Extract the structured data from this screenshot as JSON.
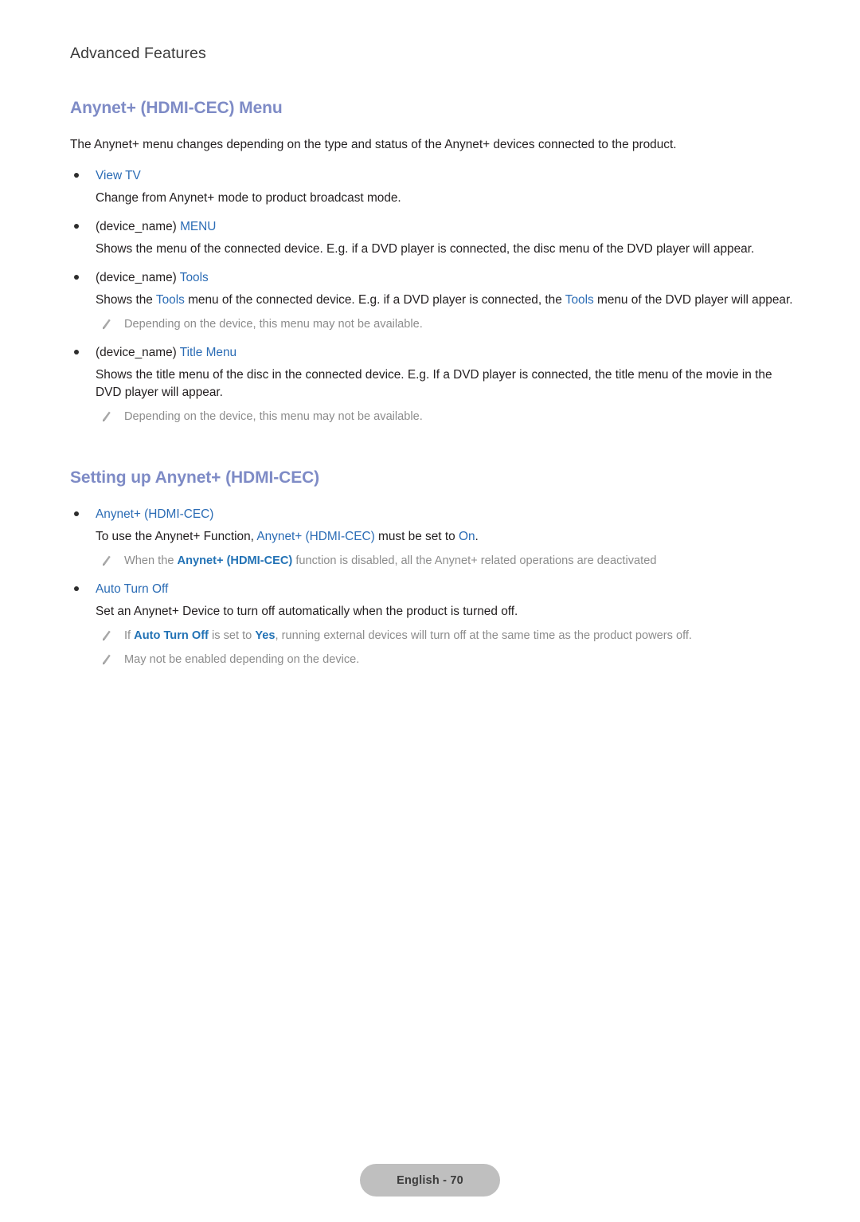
{
  "page": {
    "running_head": "Advanced Features",
    "footer_label": "English - 70"
  },
  "colors": {
    "heading": "#7e8bc6",
    "link": "#2b6cb5",
    "body_text": "#231f20",
    "note_text": "#8c8c8c",
    "badge_bg": "#bfbfbf"
  },
  "sections": [
    {
      "heading": "Anynet+ (HDMI-CEC) Menu",
      "intro": "The Anynet+ menu changes depending on the type and status of the Anynet+ devices connected to the product.",
      "items": [
        {
          "title_plain": "",
          "title_link": "View TV",
          "body": "Change from Anynet+ mode to product broadcast mode.",
          "notes": []
        },
        {
          "title_plain": "(device_name) ",
          "title_link": "MENU",
          "body_pre": "Shows the menu of the connected device. E.g. if a DVD player is connected, the disc menu of the DVD player will appear.",
          "notes": []
        },
        {
          "title_plain": "(device_name) ",
          "title_link": "Tools",
          "body_p1": "Shows the ",
          "body_l1": "Tools",
          "body_p2": " menu of the connected device. E.g. if a DVD player is connected, the ",
          "body_l2": "Tools",
          "body_p3": " menu of the DVD player will appear.",
          "notes": [
            {
              "text": "Depending on the device, this menu may not be available."
            }
          ]
        },
        {
          "title_plain": "(device_name) ",
          "title_link": "Title Menu",
          "body": "Shows the title menu of the disc in the connected device. E.g. If a DVD player is connected, the title menu of the movie in the DVD player will appear.",
          "notes": [
            {
              "text": "Depending on the device, this menu may not be available."
            }
          ]
        }
      ]
    },
    {
      "heading": "Setting up Anynet+ (HDMI-CEC)",
      "items": [
        {
          "title_link": "Anynet+ (HDMI-CEC)",
          "body_p1": "To use the Anynet+ Function, ",
          "body_l1": "Anynet+ (HDMI-CEC)",
          "body_p2": " must be set to ",
          "body_l2": "On",
          "body_p3": ".",
          "note_p1": "When the ",
          "note_l1": "Anynet+ (HDMI-CEC)",
          "note_p2": " function is disabled, all the Anynet+ related operations are deactivated"
        },
        {
          "title_link": "Auto Turn Off",
          "body": "Set an Anynet+ Device to turn off automatically when the product is turned off.",
          "note1_p1": "If ",
          "note1_l1": "Auto Turn Off",
          "note1_p2": " is set to ",
          "note1_l2": "Yes",
          "note1_p3": ", running external devices will turn off at the same time as the product powers off.",
          "note2": "May not be enabled depending on the device."
        }
      ]
    }
  ]
}
